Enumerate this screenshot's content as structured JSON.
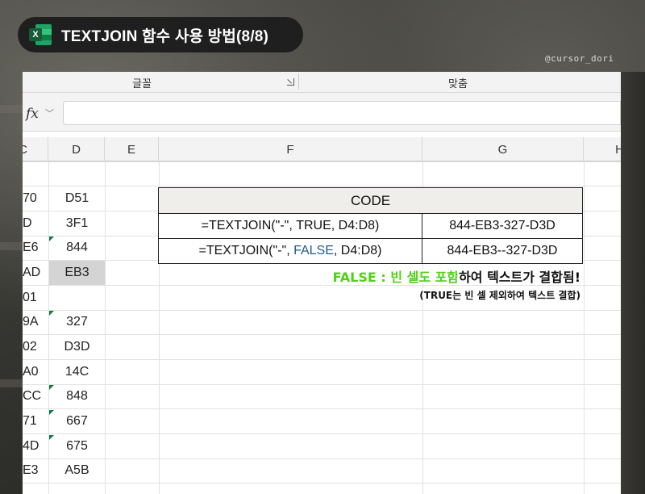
{
  "title": "TEXTJOIN 함수 사용 방법(8/8)",
  "app_icon": {
    "name": "excel-icon",
    "letter": "X",
    "color": "#21a366"
  },
  "watermark": "@cursor_dori",
  "ribbon": {
    "group_font": "글꼴",
    "group_align": "맞춤"
  },
  "formula_bar": {
    "fx": "fx",
    "chevron": "﹀",
    "value": ""
  },
  "columns": [
    "C",
    "D",
    "E",
    "F",
    "G",
    "H"
  ],
  "column_c_partial": [
    "70",
    "D",
    "E6",
    "AD",
    "01",
    "9A",
    "02",
    "A0",
    "CC",
    "71",
    "4D",
    "E3"
  ],
  "column_d": [
    "D51",
    "3F1",
    "844",
    "EB3",
    "",
    "327",
    "D3D",
    "14C",
    "848",
    "667",
    "675",
    "A5B"
  ],
  "table": {
    "header": "CODE",
    "rows": [
      {
        "formula_prefix": "=TEXTJOIN(\"-\", ",
        "formula_flag": "TRUE",
        "formula_suffix": ", D4:D8)",
        "result": "844-EB3-327-D3D"
      },
      {
        "formula_prefix": "=TEXTJOIN(\"-\", ",
        "formula_flag": "FALSE",
        "formula_suffix": ", D4:D8)",
        "result": "844-EB3--327-D3D"
      }
    ]
  },
  "notes": {
    "line1_highlight": "FALSE : 빈 셀도 포함",
    "line1_rest": "하여 텍스트가 결합됨!",
    "line2": "(TRUE는 빈 셀 제외하여 텍스트 결합)"
  },
  "colors": {
    "accent_green": "#4ed216",
    "false_blue": "#1f5a8e",
    "excel_green": "#107c41"
  }
}
